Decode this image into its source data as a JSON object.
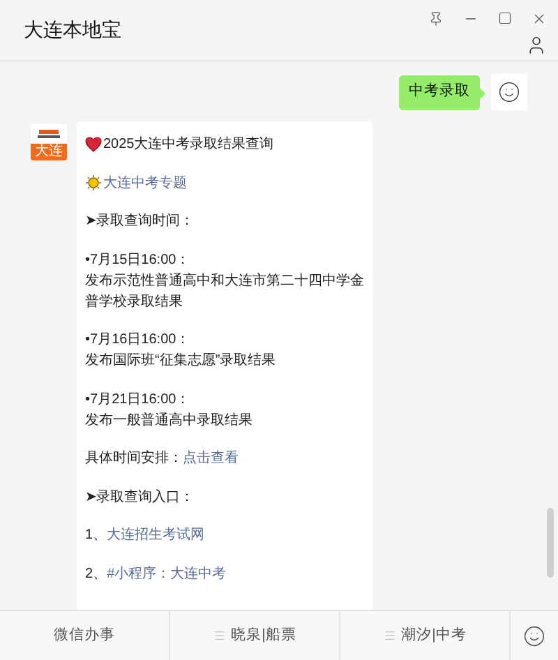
{
  "window": {
    "title": "大连本地宝"
  },
  "user_message": {
    "text": "中考录取"
  },
  "bot": {
    "avatar_label": "大连"
  },
  "article": [
    {
      "kind": "title",
      "lines": [
        [
          {
            "kind": "text",
            "text": "2025大连中考录取结果查询"
          }
        ]
      ]
    },
    {
      "kind": "topic",
      "lines": [
        [
          {
            "kind": "link",
            "text": "大连中考专题"
          }
        ]
      ]
    },
    {
      "lines": [
        [
          {
            "kind": "text",
            "text": "➤录取查询时间："
          }
        ]
      ]
    },
    {
      "lines": [
        [
          {
            "kind": "text",
            "text": "•7月15日16:00："
          }
        ],
        [
          {
            "kind": "text",
            "text": "发布示范性普通高中和大连市第二十四中学金普学校录取结果"
          }
        ]
      ]
    },
    {
      "lines": [
        [
          {
            "kind": "text",
            "text": "•7月16日16:00："
          }
        ],
        [
          {
            "kind": "text",
            "text": "发布国际班“征集志愿”录取结果"
          }
        ]
      ]
    },
    {
      "lines": [
        [
          {
            "kind": "text",
            "text": "•7月21日16:00："
          }
        ],
        [
          {
            "kind": "text",
            "text": "发布一般普通高中录取结果"
          }
        ]
      ]
    },
    {
      "lines": [
        [
          {
            "kind": "text",
            "text": "具体时间安排："
          },
          {
            "kind": "link",
            "text": "点击查看"
          }
        ]
      ]
    },
    {
      "lines": [
        [
          {
            "kind": "text",
            "text": "➤录取查询入口："
          }
        ]
      ]
    },
    {
      "lines": [
        [
          {
            "kind": "text",
            "text": "1、"
          },
          {
            "kind": "link",
            "text": "大连招生考试网"
          }
        ]
      ]
    },
    {
      "lines": [
        [
          {
            "kind": "text",
            "text": "2、"
          },
          {
            "kind": "link",
            "text": "#小程序：大连中考"
          }
        ]
      ]
    }
  ],
  "menu": [
    {
      "kind": "plain",
      "label": "微信办事"
    },
    {
      "kind": "submenu",
      "label": "晓泉|船票"
    },
    {
      "kind": "submenu",
      "label": "潮汐|中考"
    }
  ]
}
